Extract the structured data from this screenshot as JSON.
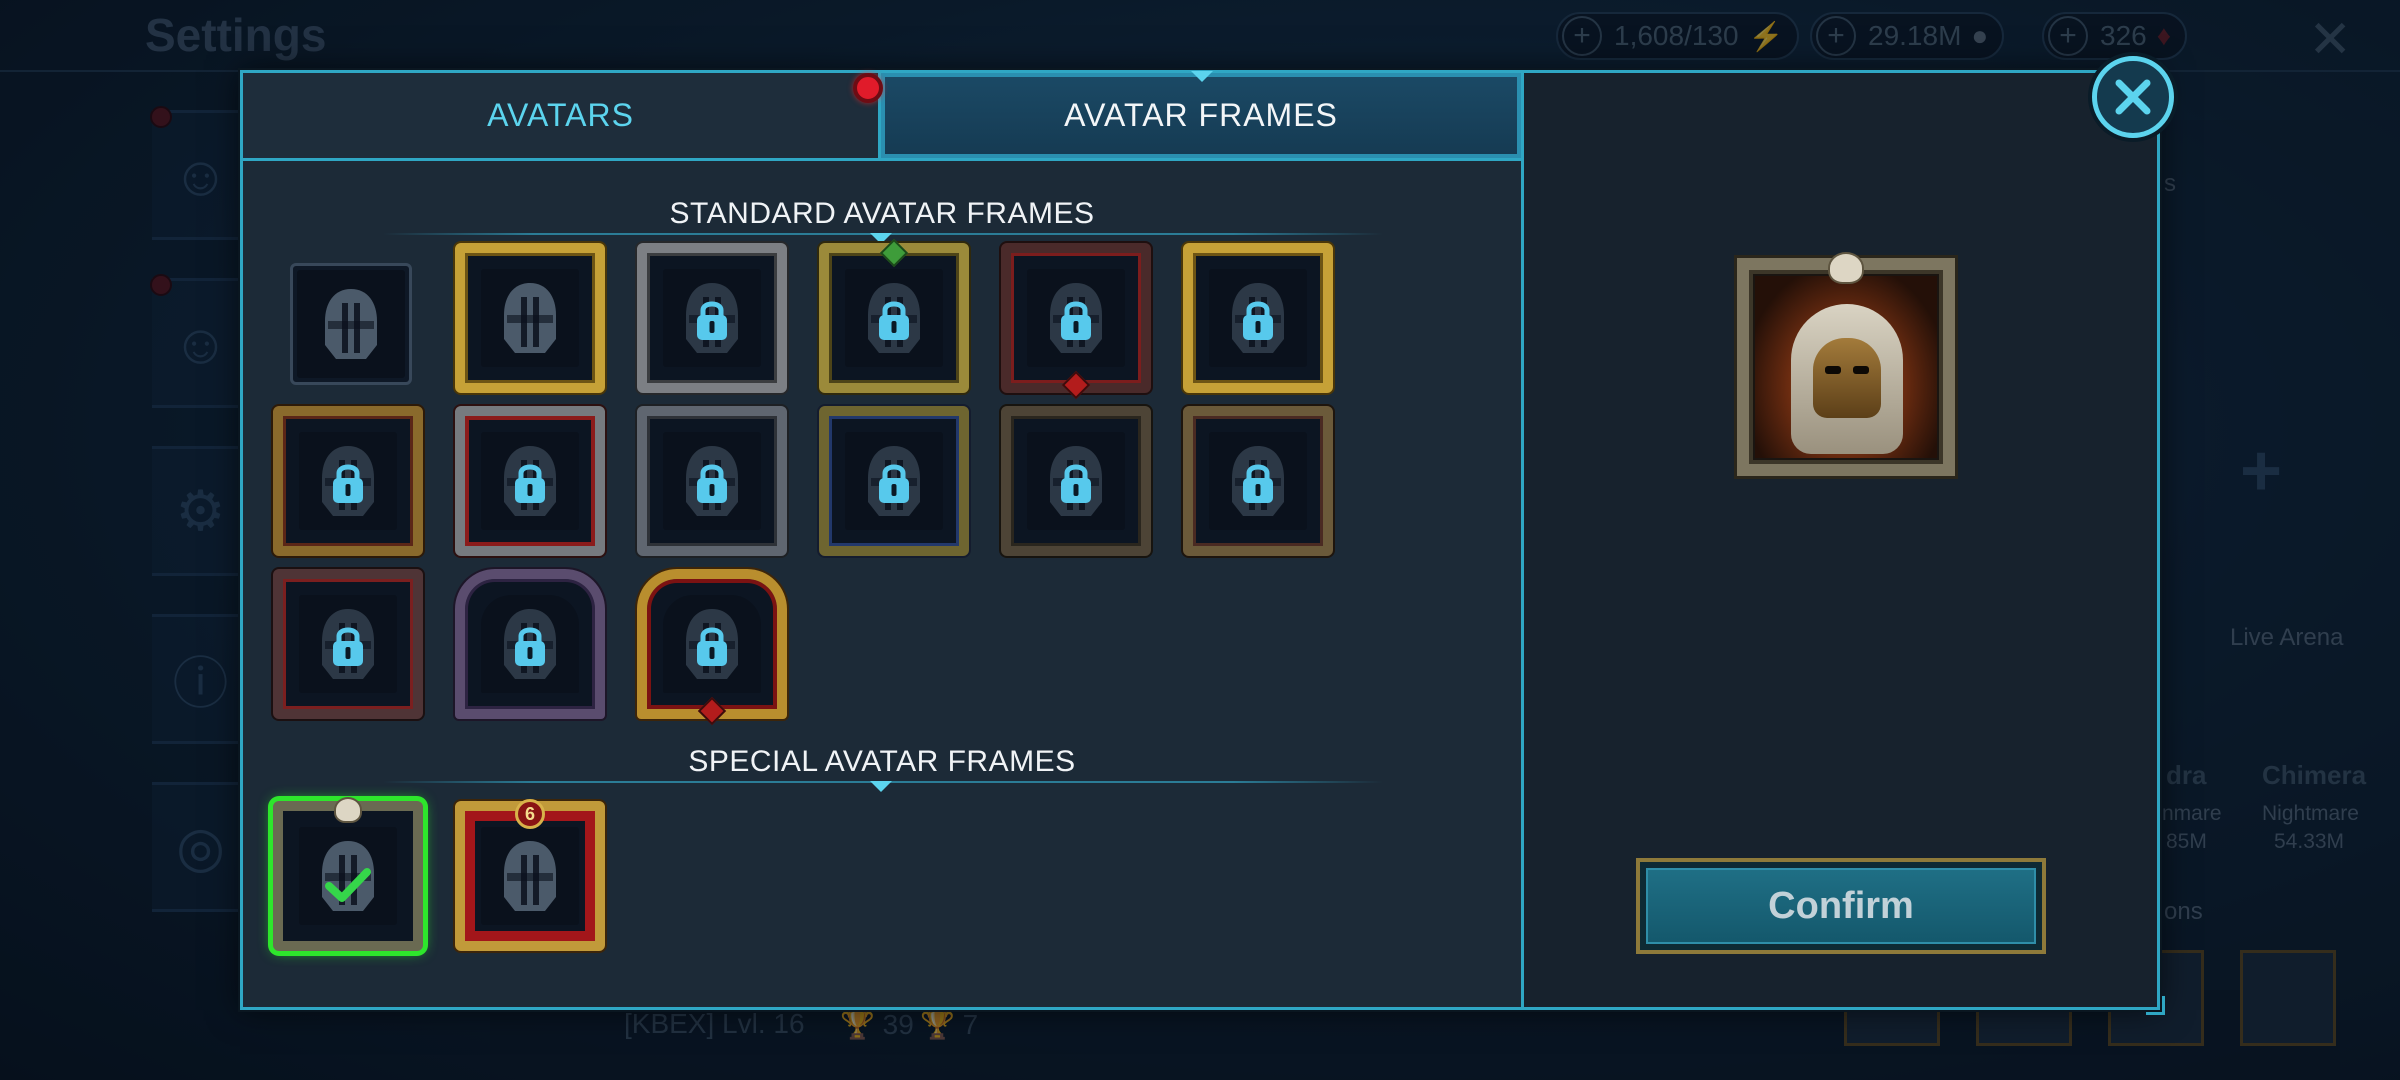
{
  "background": {
    "title": "Settings",
    "resources": [
      {
        "value": "1,608/130",
        "icon": "energy-icon"
      },
      {
        "value": "29.18M",
        "icon": "silver-icon"
      },
      {
        "value": "326",
        "icon": "gem-icon"
      }
    ],
    "right_labels": {
      "live_arena": "Live Arena",
      "hydra": "dra",
      "chimera": "Chimera",
      "nightmare1": "nmare",
      "nightmare2": "Nightmare",
      "value1": "85M",
      "value2": "54.33M",
      "section1": "s",
      "section2": "ons"
    },
    "clan": {
      "name": "[KBEX] Lvl. 16",
      "trophies": "39",
      "cups": "7"
    }
  },
  "modal": {
    "tabs": [
      {
        "label": "AVATARS",
        "active": false
      },
      {
        "label": "AVATAR FRAMES",
        "active": true
      }
    ],
    "standard_section": {
      "title": "STANDARD AVATAR FRAMES",
      "frames": [
        {
          "style": "plain",
          "locked": false
        },
        {
          "style": "gold",
          "locked": false
        },
        {
          "style": "silver",
          "locked": true
        },
        {
          "style": "olive",
          "locked": true
        },
        {
          "style": "darkred",
          "locked": true
        },
        {
          "style": "gold",
          "locked": true
        },
        {
          "style": "bronze",
          "locked": true
        },
        {
          "style": "redsilver",
          "locked": true
        },
        {
          "style": "steel",
          "locked": true
        },
        {
          "style": "blue",
          "locked": true
        },
        {
          "style": "chain",
          "locked": true
        },
        {
          "style": "rust",
          "locked": true
        },
        {
          "style": "spike",
          "locked": true
        },
        {
          "style": "arch",
          "locked": true
        },
        {
          "style": "castle",
          "locked": true
        }
      ]
    },
    "special_section": {
      "title": "SPECIAL AVATAR FRAMES",
      "frames": [
        {
          "style": "selected",
          "selected": true
        },
        {
          "style": "curtain",
          "selected": false,
          "badge": "6"
        }
      ]
    },
    "confirm_label": "Confirm"
  },
  "colors": {
    "accent": "#2fa7c4",
    "tab_active_text": "#f3f6f8",
    "tab_inactive_text": "#5cd4ee",
    "selected_glow": "#2ee62c",
    "lock_icon": "#57c9ec",
    "notification": "#e01b2a"
  }
}
